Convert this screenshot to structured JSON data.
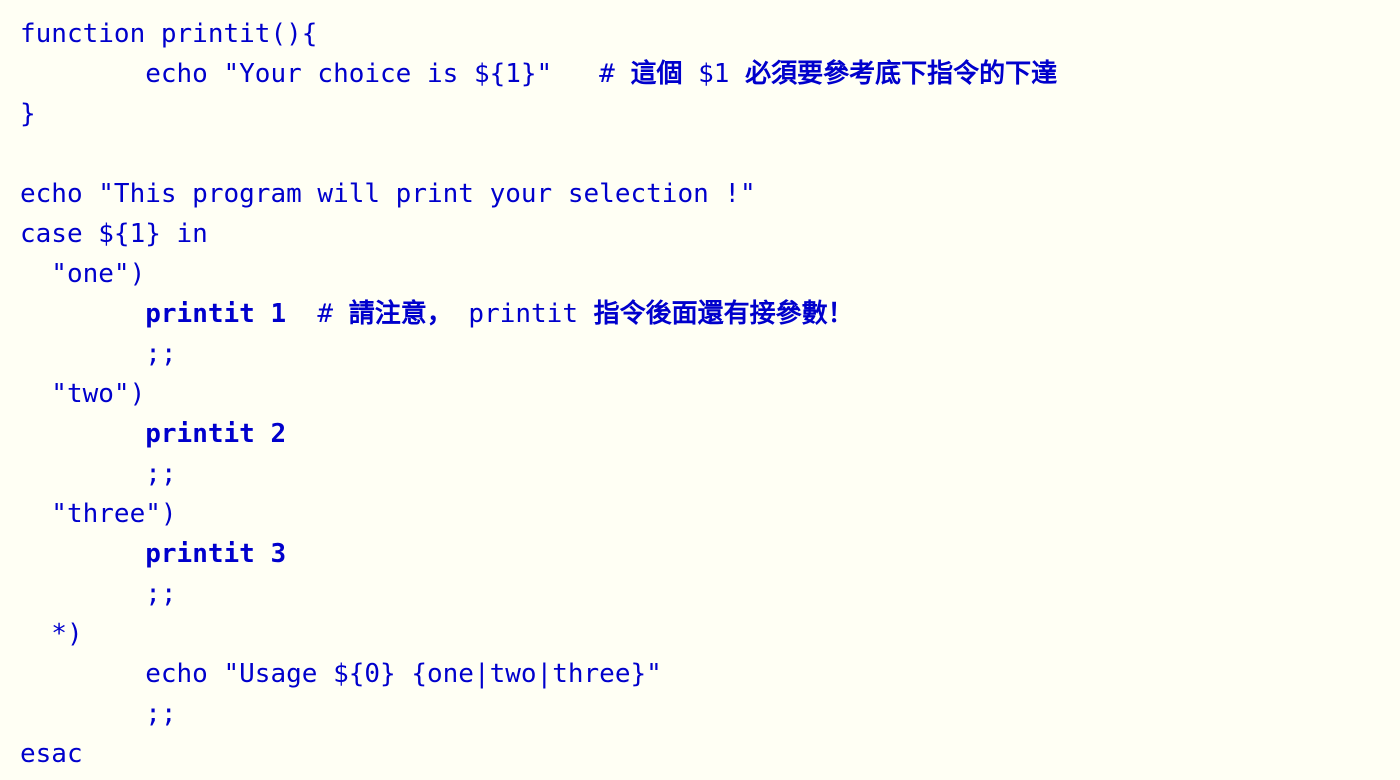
{
  "lines": {
    "l01": "function printit(){",
    "l02_code": "        echo \"Your choice is ${1}\"   # ",
    "l02_cjk1": "這個",
    "l02_mid": " $1 ",
    "l02_cjk2": "必須要參考底下指令的下達",
    "l03": "}",
    "l04": "",
    "l05": "echo \"This program will print your selection !\"",
    "l06": "case ${1} in",
    "l07": "  \"one\")",
    "l08_indent": "        ",
    "l08_bold": "printit 1",
    "l08_hash": "  # ",
    "l08_cjk1": "請注意，",
    "l08_mid": " printit ",
    "l08_cjk2": "指令後面還有接參數！",
    "l09": "        ;;",
    "l10": "  \"two\")",
    "l11_indent": "        ",
    "l11_bold": "printit 2",
    "l12": "        ;;",
    "l13": "  \"three\")",
    "l14_indent": "        ",
    "l14_bold": "printit 3",
    "l15": "        ;;",
    "l16": "  *)",
    "l17": "        echo \"Usage ${0} {one|two|three}\"",
    "l18": "        ;;",
    "l19": "esac"
  }
}
